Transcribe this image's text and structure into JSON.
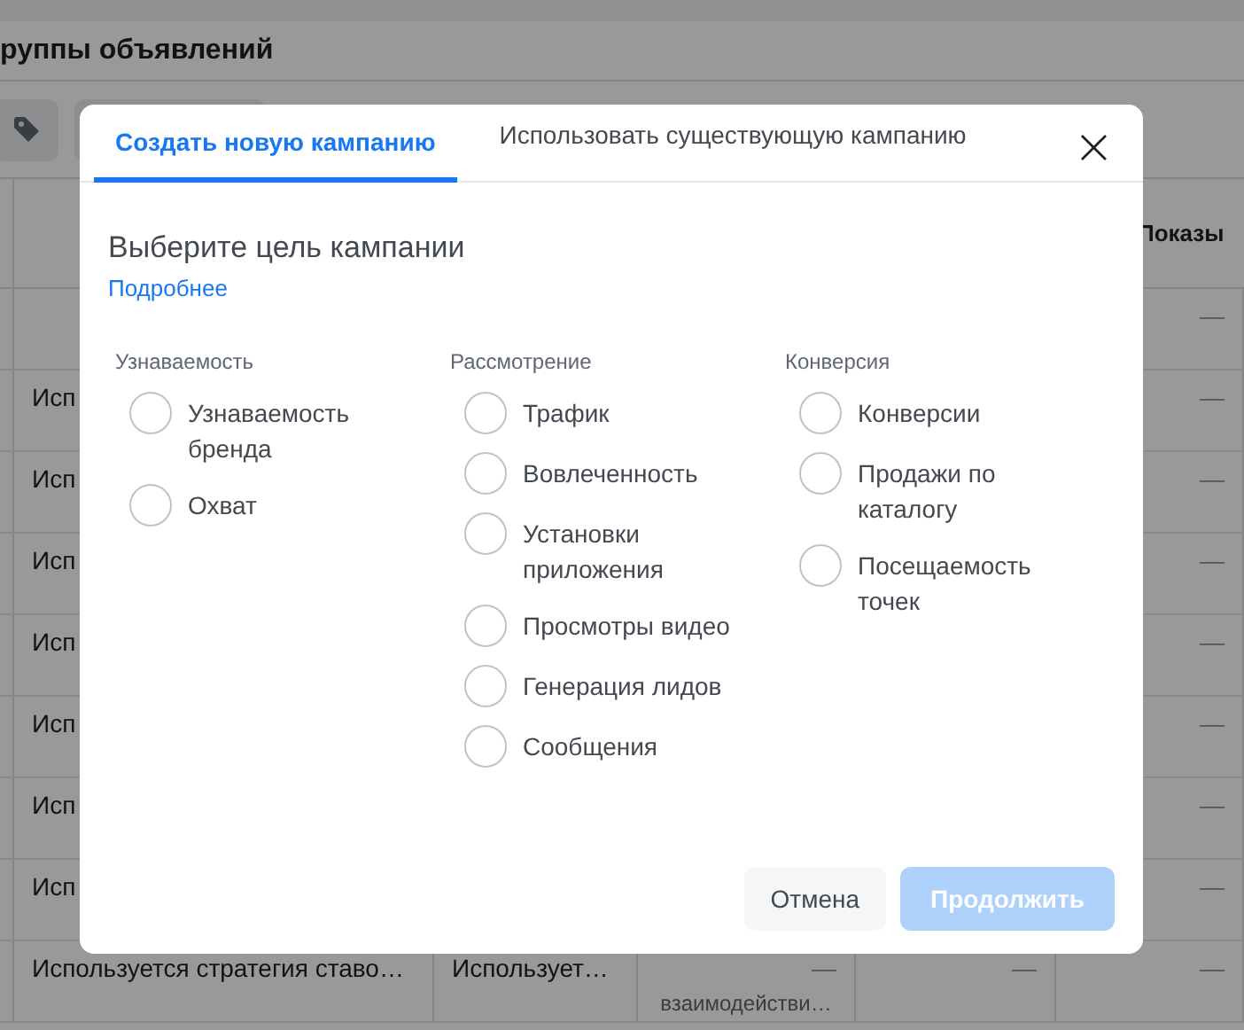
{
  "page": {
    "title": "руппы объявлений"
  },
  "table": {
    "columns": [
      {
        "label": "Показы"
      }
    ],
    "rows": [
      {
        "column_5": "—"
      },
      {
        "column_1": "Исп",
        "column_5": "—"
      },
      {
        "column_1": "Исп",
        "column_5": "—"
      },
      {
        "column_1": "Исп",
        "column_5": "—"
      },
      {
        "column_1": "Исп",
        "column_5": "—"
      },
      {
        "column_1": "Исп",
        "column_5": "—"
      },
      {
        "column_1": "Исп",
        "column_5": "—"
      },
      {
        "column_1": "Исп",
        "column_5": "—"
      },
      {
        "column_1": "Используется стратегия ставо…",
        "column_2": "Использует…",
        "column_3": "—",
        "column_3_note": "взаимодействи…",
        "column_4": "—",
        "column_5": "—"
      }
    ]
  },
  "dialog": {
    "tabs": [
      {
        "label": "Создать новую кампанию",
        "selected": true
      },
      {
        "label": "Использовать существующую кампанию",
        "selected": false
      }
    ],
    "close": "×",
    "heading": "Выберите цель кампании",
    "link": "Подробнее",
    "groups": [
      {
        "title": "Узнаваемость",
        "options": [
          {
            "label": "Узнаваемость бренда",
            "selected": false
          },
          {
            "label": "Охват",
            "selected": false
          }
        ]
      },
      {
        "title": "Рассмотрение",
        "options": [
          {
            "label": "Трафик",
            "selected": false
          },
          {
            "label": "Вовлеченность",
            "selected": false
          },
          {
            "label": "Установки приложения",
            "selected": false
          },
          {
            "label": "Просмотры видео",
            "selected": false
          },
          {
            "label": "Генерация лидов",
            "selected": false
          },
          {
            "label": "Сообщения",
            "selected": false
          }
        ]
      },
      {
        "title": "Конверсия",
        "options": [
          {
            "label": "Конверсии",
            "selected": false
          },
          {
            "label": "Продажи по каталогу",
            "selected": false
          },
          {
            "label": "Посещаемость точек",
            "selected": false
          }
        ]
      }
    ],
    "buttons": [
      {
        "label": "Отмена",
        "kind": "secondary",
        "disabled": false
      },
      {
        "label": "Продолжить",
        "kind": "primary",
        "disabled": true
      }
    ]
  }
}
